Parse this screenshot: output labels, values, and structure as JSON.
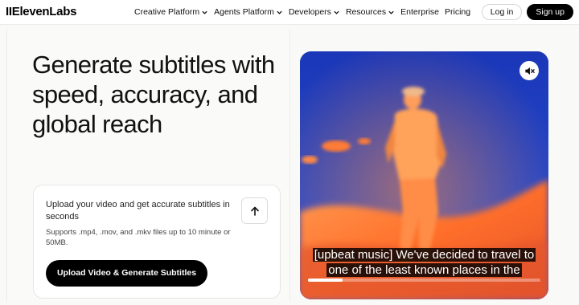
{
  "nav": {
    "logo": "IIElevenLabs",
    "menu": [
      {
        "label": "Creative Platform",
        "dropdown": true
      },
      {
        "label": "Agents Platform",
        "dropdown": true
      },
      {
        "label": "Developers",
        "dropdown": true
      },
      {
        "label": "Resources",
        "dropdown": true
      },
      {
        "label": "Enterprise",
        "dropdown": false
      },
      {
        "label": "Pricing",
        "dropdown": false
      }
    ],
    "login_label": "Log in",
    "signup_label": "Sign up"
  },
  "hero": {
    "headline": "Generate subtitles with speed, accuracy, and global reach"
  },
  "upload": {
    "title": "Upload your video and get accurate subtitles in seconds",
    "note": "Supports .mp4, .mov, and .mkv files up to 10 minute or 50MB.",
    "arrow_icon": "arrow-up-icon",
    "cta_label": "Upload Video & Generate Subtitles"
  },
  "video": {
    "mute_icon": "speaker-muted-icon",
    "subtitle_line1": "[upbeat music] We've decided to travel to",
    "subtitle_line2": "one of the least known places in the",
    "progress": 0.15
  },
  "colors": {
    "accent": "#000000",
    "video_blue": "#1f3dba",
    "video_orange": "#ff7a2e"
  }
}
